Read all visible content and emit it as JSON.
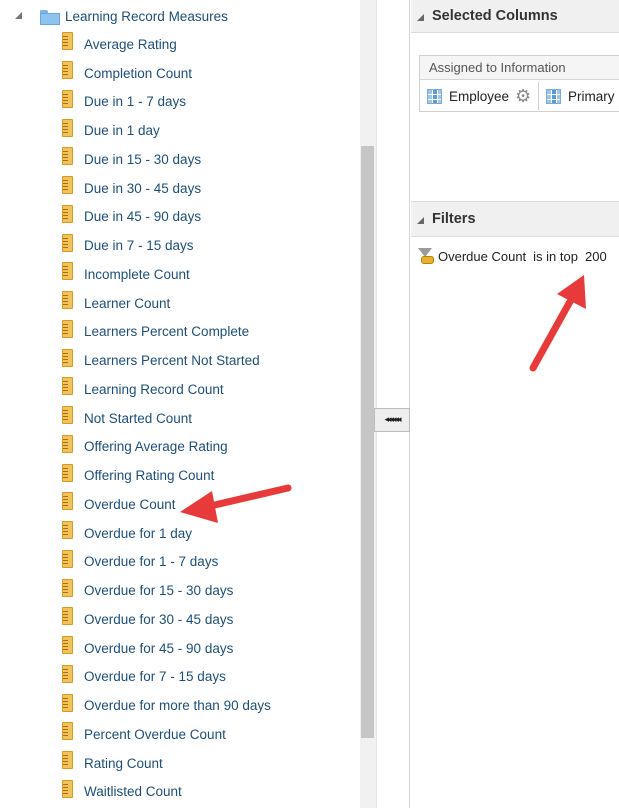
{
  "tree": {
    "root_label": "Learning Record Measures",
    "items": [
      "Average Rating",
      "Completion Count",
      "Due in 1 - 7 days",
      "Due in 1 day",
      "Due in 15 - 30 days",
      "Due in 30 - 45 days",
      "Due in 45 - 90 days",
      "Due in 7 - 15 days",
      "Incomplete Count",
      "Learner Count",
      "Learners Percent Complete",
      "Learners Percent Not Started",
      "Learning Record Count",
      "Not Started Count",
      "Offering Average Rating",
      "Offering Rating Count",
      "Overdue Count",
      "Overdue for 1 day",
      "Overdue for 1 - 7 days",
      "Overdue for 15 - 30 days",
      "Overdue for 30 - 45 days",
      "Overdue for 45 - 90 days",
      "Overdue for 7 - 15 days",
      "Overdue for more than 90 days",
      "Percent Overdue Count",
      "Rating Count",
      "Waitlisted Count"
    ]
  },
  "splitter": {
    "move_glyph": "◂◂◂◂◂◂"
  },
  "selected_columns": {
    "title": "Selected Columns",
    "group_label": "Assigned to Information",
    "columns": [
      "Employee",
      "Primary"
    ]
  },
  "filters": {
    "title": "Filters",
    "column": "Overdue Count",
    "operator": "is in top",
    "value": "200"
  },
  "colors": {
    "link_text": "#1e4f7a",
    "annotation_arrow": "#e8393b"
  },
  "icons": {
    "tree_root": "folder-icon",
    "tree_item": "ruler-measure-icon",
    "column": "grid-icon",
    "column_options": "gear-icon",
    "filter": "filter-key-icon"
  }
}
